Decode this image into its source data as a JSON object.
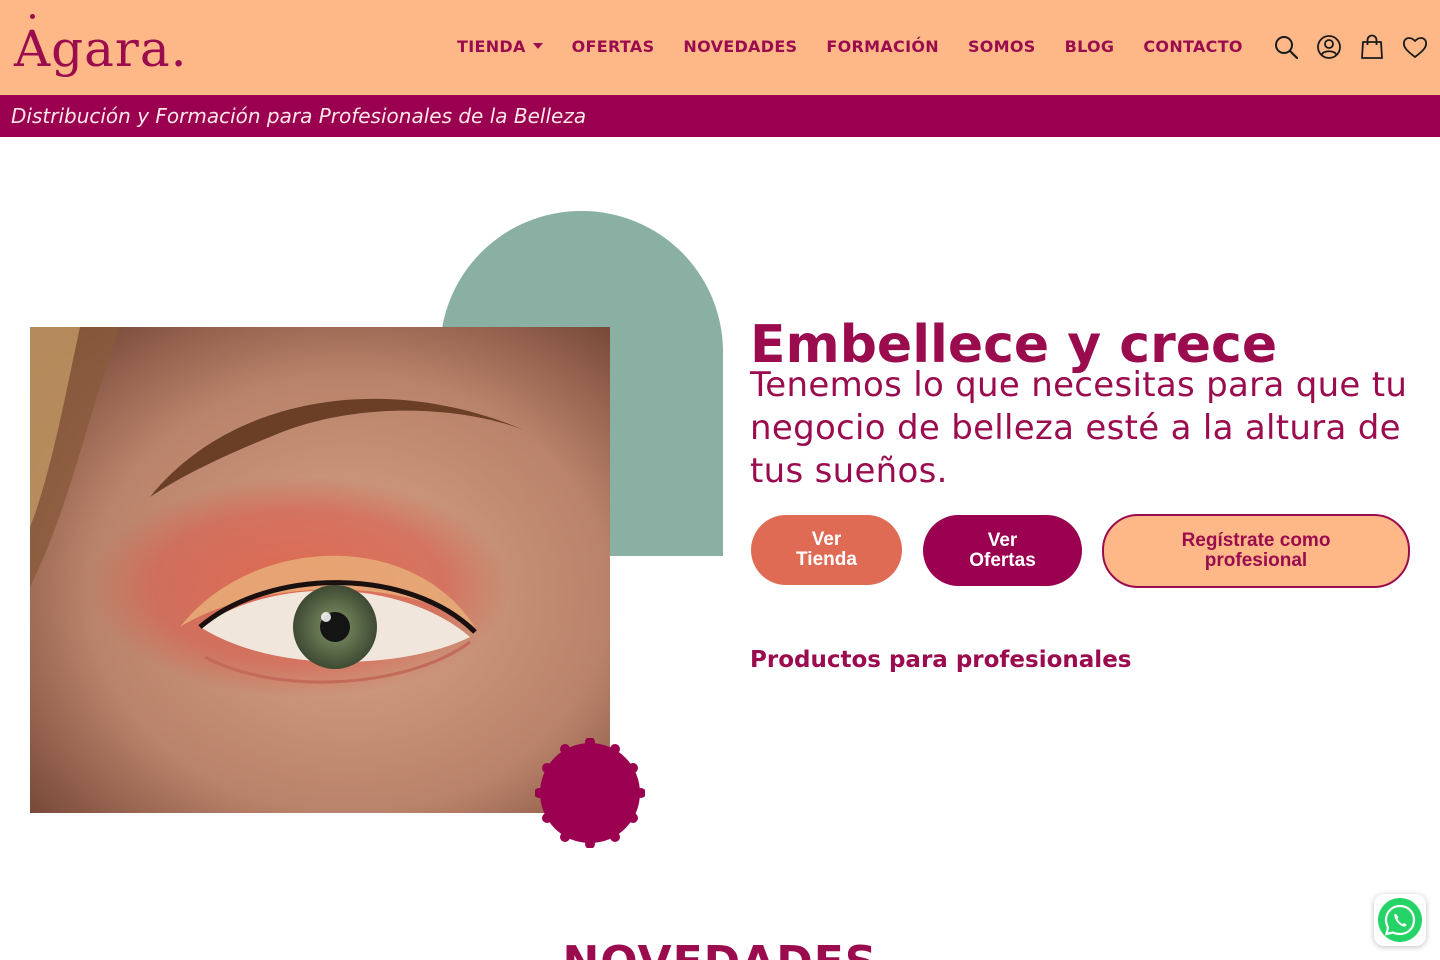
{
  "brand": {
    "name": "Agara.",
    "color": "#9b0c4e",
    "header_bg": "#feb887"
  },
  "nav": {
    "items": [
      {
        "label": "TIENDA",
        "has_dropdown": true
      },
      {
        "label": "OFERTAS"
      },
      {
        "label": "NOVEDADES"
      },
      {
        "label": "FORMACIÓN"
      },
      {
        "label": "SOMOS"
      },
      {
        "label": "BLOG"
      },
      {
        "label": "CONTACTO"
      }
    ]
  },
  "header_icons": [
    "search-icon",
    "user-account-icon",
    "shopping-bag-icon",
    "wishlist-heart-icon"
  ],
  "tagline": "Distribución y Formación para Profesionales de la Belleza",
  "hero": {
    "title": "Embellece y crece",
    "subtitle": "Tenemos lo que necesitas para que tu negocio de belleza esté a la altura de tus sueños.",
    "buttons": {
      "tienda": "Ver Tienda",
      "ofertas": "Ver Ofertas",
      "registro": "Regístrate como profesional"
    },
    "products_link": "Productos para profesionales",
    "image": "close-up of eye with coral eyeshadow"
  },
  "section": {
    "title": "NOVEDADES"
  },
  "floating": {
    "icon": "whatsapp-icon"
  },
  "colors": {
    "accent_magenta": "#9b0050",
    "sage": "#8aafa3",
    "coral": "#e06b54",
    "peach": "#feb887"
  }
}
